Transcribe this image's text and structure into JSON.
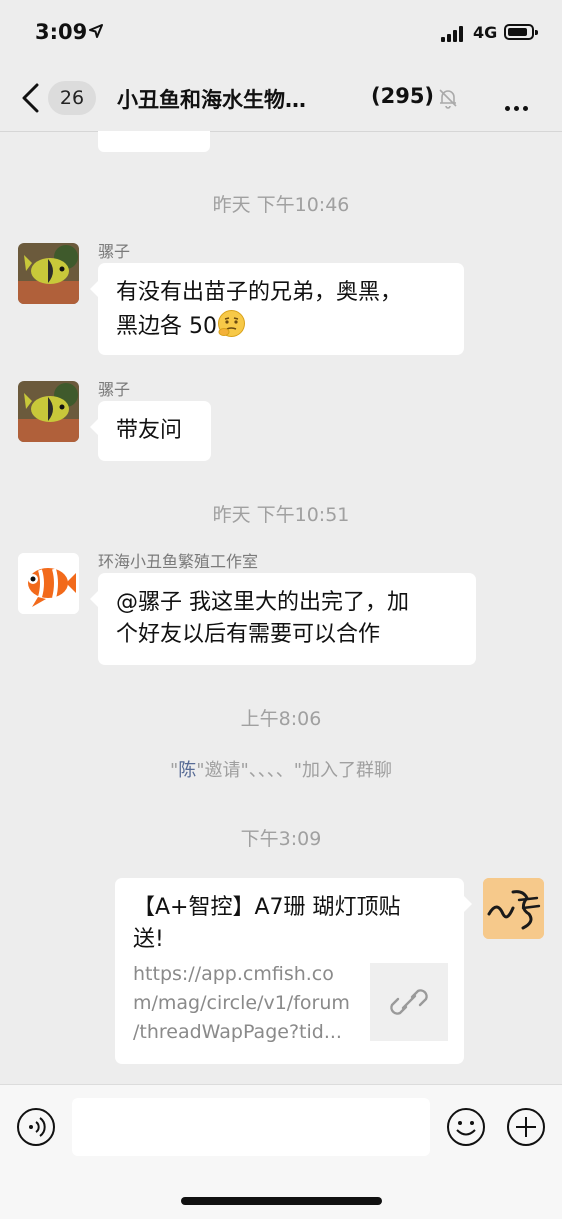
{
  "status_bar": {
    "time": "3:09",
    "network": "4G"
  },
  "nav": {
    "unread_count": "26",
    "title": "小丑鱼和海水生物…",
    "member_count": "(295)"
  },
  "messages": {
    "time_1": "昨天 下午10:46",
    "msg_1": {
      "sender": "骡子",
      "text_1": "有没有出苗子的兄弟，奥黑，",
      "text_2": "黑边各 50"
    },
    "msg_2": {
      "sender": "骡子",
      "text": "带友问"
    },
    "time_2": "昨天 下午10:51",
    "msg_3": {
      "sender": "环海小丑鱼繁殖工作室",
      "text_1": "@骡子 我这里大的出完了，加",
      "text_2": "个好友以后有需要可以合作"
    },
    "time_3": "上午8:06",
    "system": {
      "quote_open": "\"",
      "name": "陈",
      "rest": "\"邀请\"、、、、\"加入了群聊"
    },
    "time_4": "下午3:09",
    "link_card": {
      "title_1": "【A+智控】A7珊 瑚灯顶贴",
      "title_2": "送!",
      "desc_1": "https://app.cmfish.co",
      "desc_2": "m/mag/circle/v1/forum",
      "desc_3": "/threadWapPage?tid..."
    }
  },
  "input": {
    "placeholder": ""
  },
  "colors": {
    "background": "#ededed",
    "bubble": "#ffffff",
    "system_link": "#576b95",
    "timestamp": "#a0a0a0"
  }
}
